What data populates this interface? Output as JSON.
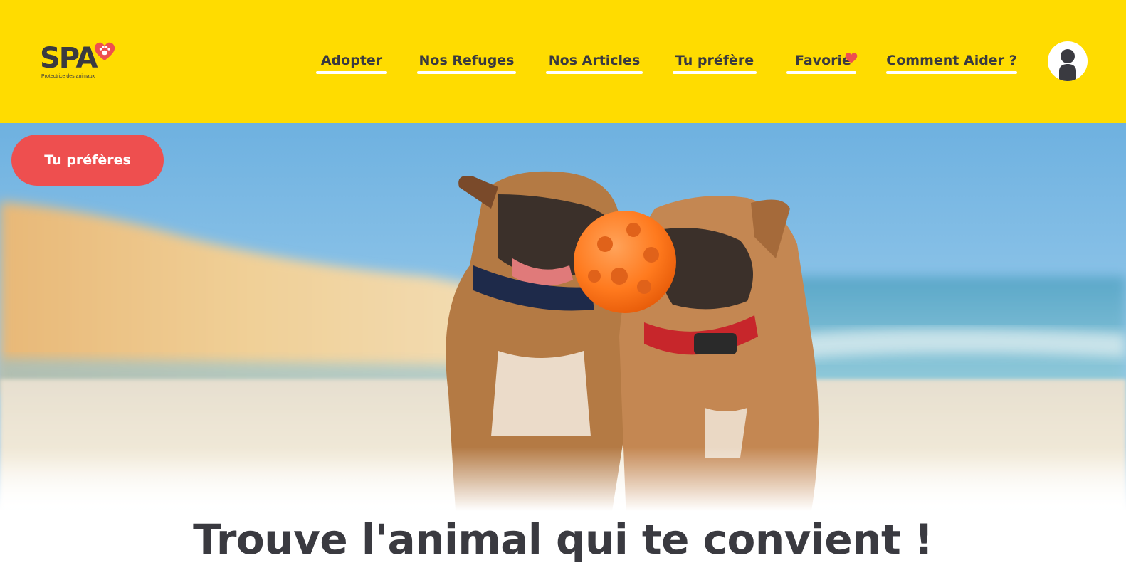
{
  "brand": {
    "logo_text": "SPA",
    "logo_subtitle": "Protectrice des animaux",
    "yellow": "#ffdc00",
    "red": "#ee4f4f",
    "dark": "#3a3a40"
  },
  "nav": {
    "items": [
      {
        "label": "Adopter"
      },
      {
        "label": "Nos Refuges"
      },
      {
        "label": "Nos Articles"
      },
      {
        "label": "Tu préfère"
      },
      {
        "label": "Favorie",
        "icon": "heart-icon"
      },
      {
        "label": "Comment Aider ?"
      }
    ],
    "account_icon": "user-avatar-icon"
  },
  "hero": {
    "image": "two-french-bulldogs-with-orange-ball-on-beach",
    "button_label": "Tu préfères"
  },
  "headline": "Trouve l'animal qui te convient !"
}
